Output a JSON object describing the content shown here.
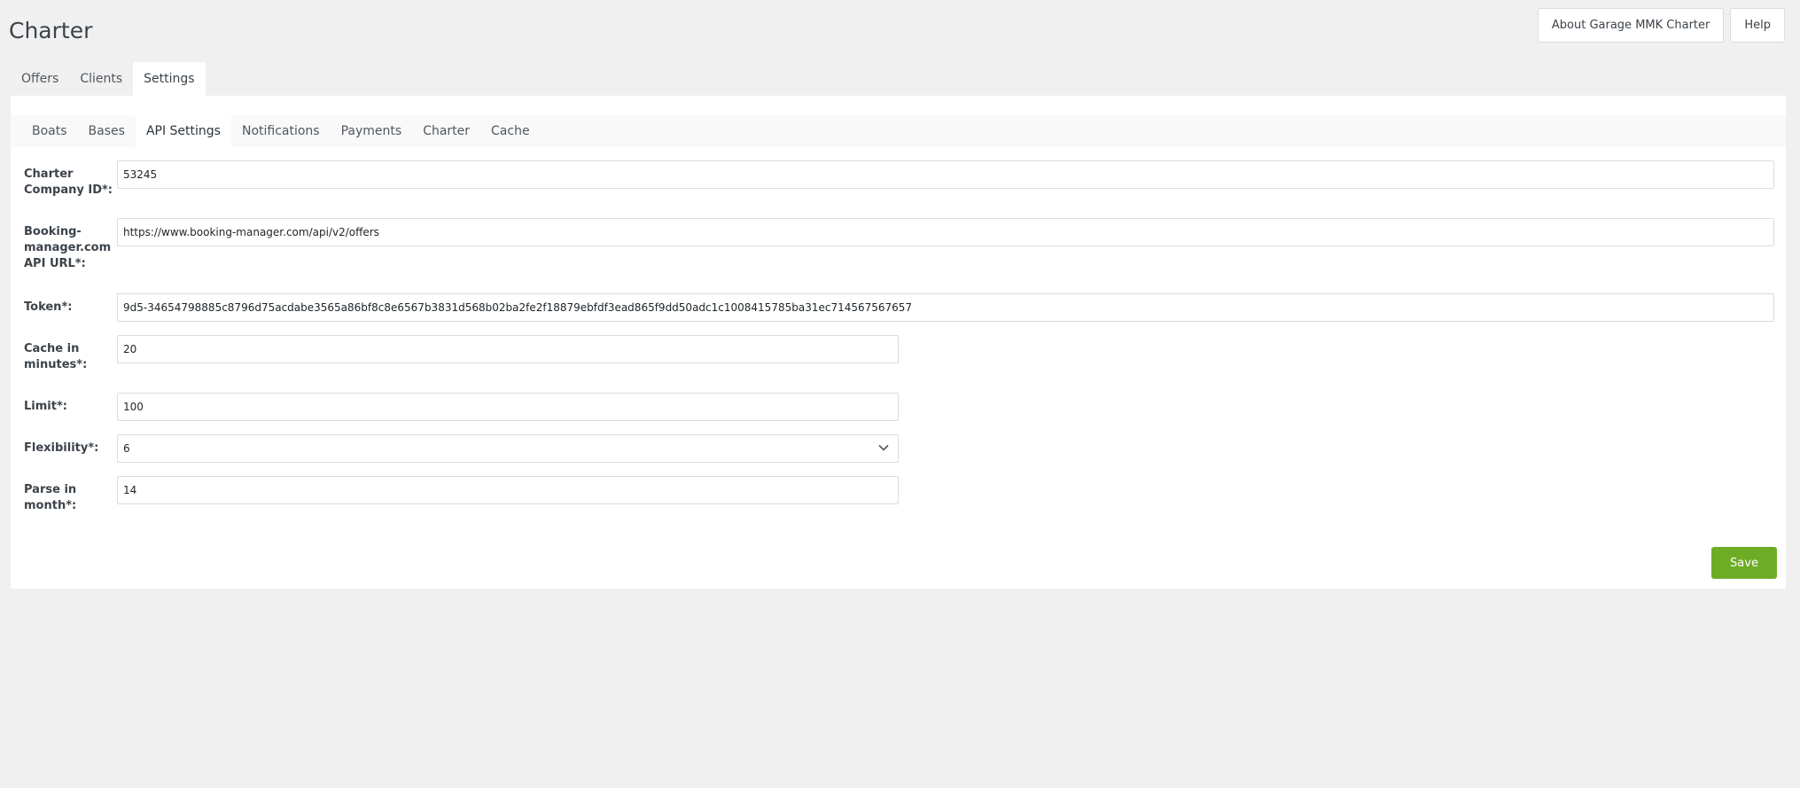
{
  "header": {
    "title": "Charter",
    "about_label": "About Garage MMK Charter",
    "help_label": "Help"
  },
  "main_tabs": [
    {
      "label": "Offers",
      "active": false
    },
    {
      "label": "Clients",
      "active": false
    },
    {
      "label": "Settings",
      "active": true
    }
  ],
  "sub_tabs": [
    {
      "label": "Boats",
      "active": false
    },
    {
      "label": "Bases",
      "active": false
    },
    {
      "label": "API Settings",
      "active": true
    },
    {
      "label": "Notifications",
      "active": false
    },
    {
      "label": "Payments",
      "active": false
    },
    {
      "label": "Charter",
      "active": false
    },
    {
      "label": "Cache",
      "active": false
    }
  ],
  "form": {
    "company_id": {
      "label": "Charter Company ID*:",
      "value": "53245"
    },
    "api_url": {
      "label": "Booking-manager.com API URL*:",
      "value": "https://www.booking-manager.com/api/v2/offers"
    },
    "token": {
      "label": "Token*:",
      "value": "9d5-34654798885c8796d75acdabe3565a86bf8c8e6567b3831d568b02ba2fe2f18879ebfdf3ead865f9dd50adc1c1008415785ba31ec714567567657"
    },
    "cache_minutes": {
      "label": "Cache in minutes*:",
      "value": "20"
    },
    "limit": {
      "label": "Limit*:",
      "value": "100"
    },
    "flexibility": {
      "label": "Flexibility*:",
      "value": "6"
    },
    "parse_month": {
      "label": "Parse in month*:",
      "value": "14"
    }
  },
  "save_label": "Save"
}
